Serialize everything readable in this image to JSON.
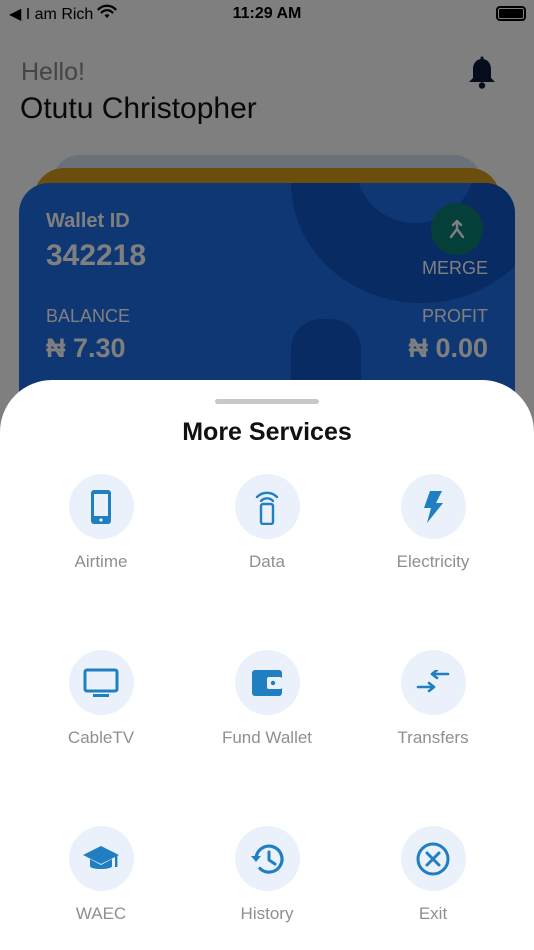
{
  "status_bar": {
    "carrier": "◀ I am Rich",
    "time": "11:29 AM"
  },
  "header": {
    "greeting": "Hello!",
    "user_name": "Otutu Christopher"
  },
  "wallet_card": {
    "wallet_id_label": "Wallet ID",
    "wallet_id": "342218",
    "merge_label": "MERGE",
    "balance_label": "BALANCE",
    "balance_value": "₦ 7.30",
    "profit_label": "PROFIT",
    "profit_value": "₦ 0.00"
  },
  "sheet": {
    "title": "More Services",
    "services": [
      {
        "label": "Airtime",
        "icon": "phone-icon"
      },
      {
        "label": "Data",
        "icon": "data-icon"
      },
      {
        "label": "Electricity",
        "icon": "lightning-icon"
      },
      {
        "label": "CableTV",
        "icon": "tv-icon"
      },
      {
        "label": "Fund Wallet",
        "icon": "wallet-icon"
      },
      {
        "label": "Transfers",
        "icon": "transfer-icon"
      },
      {
        "label": "WAEC",
        "icon": "graduation-cap-icon"
      },
      {
        "label": "History",
        "icon": "history-icon"
      },
      {
        "label": "Exit",
        "icon": "exit-icon"
      }
    ]
  },
  "colors": {
    "accent": "#1f7fc0",
    "icon_bg": "#eaf1fb",
    "card_blue": "#1f6fe8",
    "card_gold": "#d79b1a",
    "merge_green": "#0a7f72"
  }
}
